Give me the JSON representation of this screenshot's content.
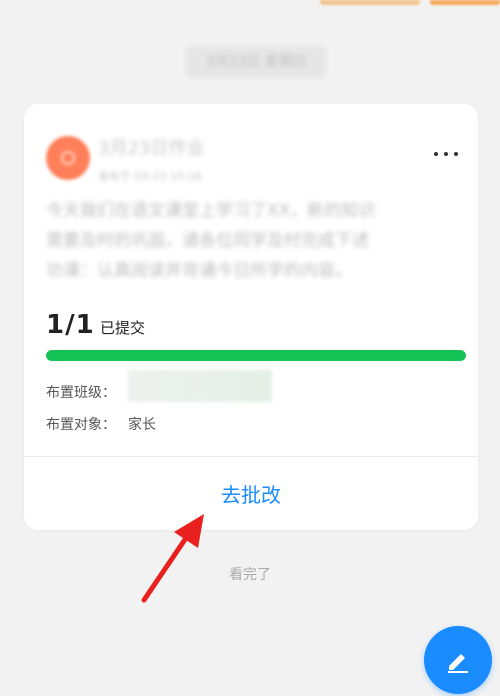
{
  "feed": {
    "date_separator": "3月23日 星期日",
    "end_text": "看完了"
  },
  "card": {
    "title": "3月23日作业",
    "meta": "发布于 03-23 15:16",
    "description_lines": [
      "今天我们在语文课堂上学习了XX，新的知识",
      "需要及时的巩固，请各位同学及时完成下述",
      "功课：认真阅读并背诵今日所学的内容。"
    ],
    "progress": {
      "count": "1/1",
      "status": "已提交",
      "fraction": 1.0
    },
    "assigned_class_label": "布置班级：",
    "assigned_target_label": "布置对象：",
    "assigned_target_value": "家长",
    "grade_button_label": "去批改"
  },
  "colors": {
    "accent": "#1a8cff",
    "progress": "#14c256",
    "avatar": "#ff7f5a",
    "arrow": "#e8201e"
  },
  "icons": {
    "more": "more-horizontal-icon",
    "edit": "pencil-icon",
    "arrow": "annotation-arrow"
  }
}
